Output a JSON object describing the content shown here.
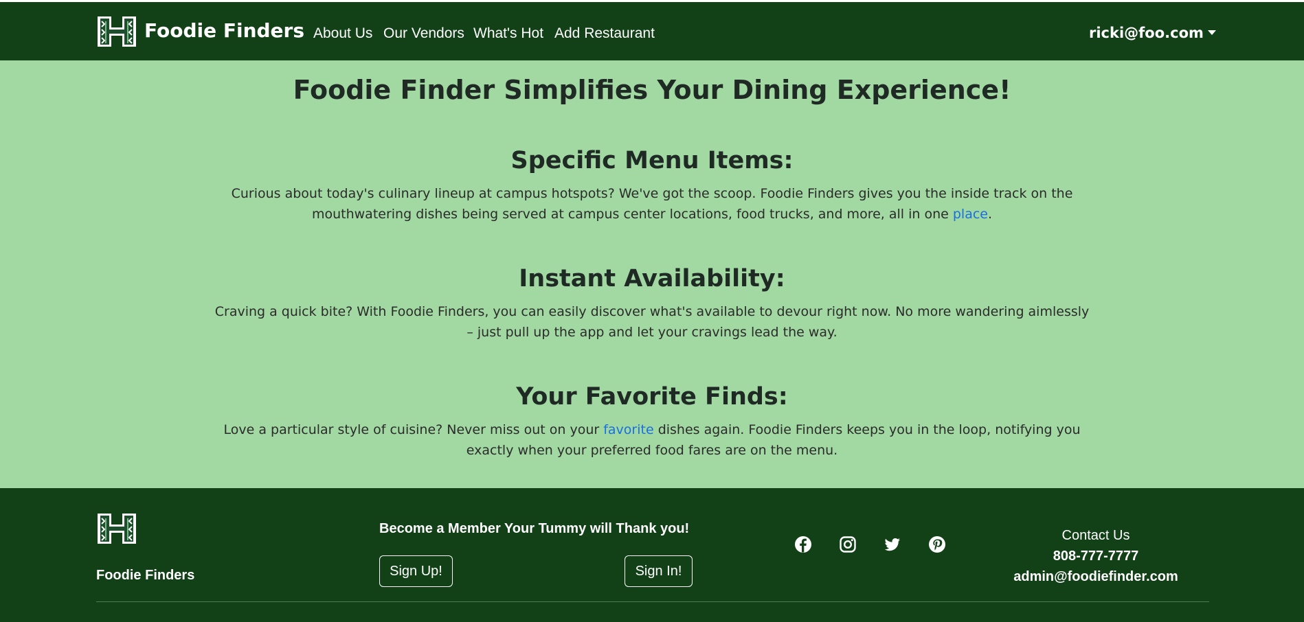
{
  "navbar": {
    "brand": "Foodie Finders",
    "links": [
      "About Us",
      "Our Vendors",
      "What's Hot",
      "Add Restaurant"
    ],
    "user": "ricki@foo.com"
  },
  "main": {
    "title": "Foodie Finder Simplifies Your Dining Experience!",
    "sections": [
      {
        "heading": "Specific Menu Items:",
        "text_before": "Curious about today's culinary lineup at campus hotspots? We've got the scoop. Foodie Finders gives you the inside track on the mouthwatering dishes being served at campus center locations, food trucks, and more, all in one ",
        "link": "place",
        "text_after": "."
      },
      {
        "heading": "Instant Availability:",
        "text": "Craving a quick bite? With Foodie Finders, you can easily discover what's available to devour right now. No more wandering aimlessly – just pull up the app and let your cravings lead the way."
      },
      {
        "heading": "Your Favorite Finds:",
        "text_before": "Love a particular style of cuisine? Never miss out on your ",
        "link": "favorite",
        "text_after": " dishes again. Foodie Finders keeps you in the loop, notifying you exactly when your preferred food fares are on the menu."
      }
    ]
  },
  "footer": {
    "brand": "Foodie Finders",
    "member_text": "Become a Member Your Tummy will Thank you!",
    "signup_label": "Sign Up!",
    "signin_label": "Sign In!",
    "social_icons": [
      "facebook-icon",
      "instagram-icon",
      "twitter-icon",
      "pinterest-icon"
    ],
    "contact_label": "Contact Us",
    "phone": "808-777-7777",
    "email": "admin@foodiefinder.com"
  },
  "colors": {
    "nav_bg": "#124118",
    "page_bg": "#a2d8a2",
    "link": "#1a6fe0",
    "text": "#1f2a24"
  }
}
